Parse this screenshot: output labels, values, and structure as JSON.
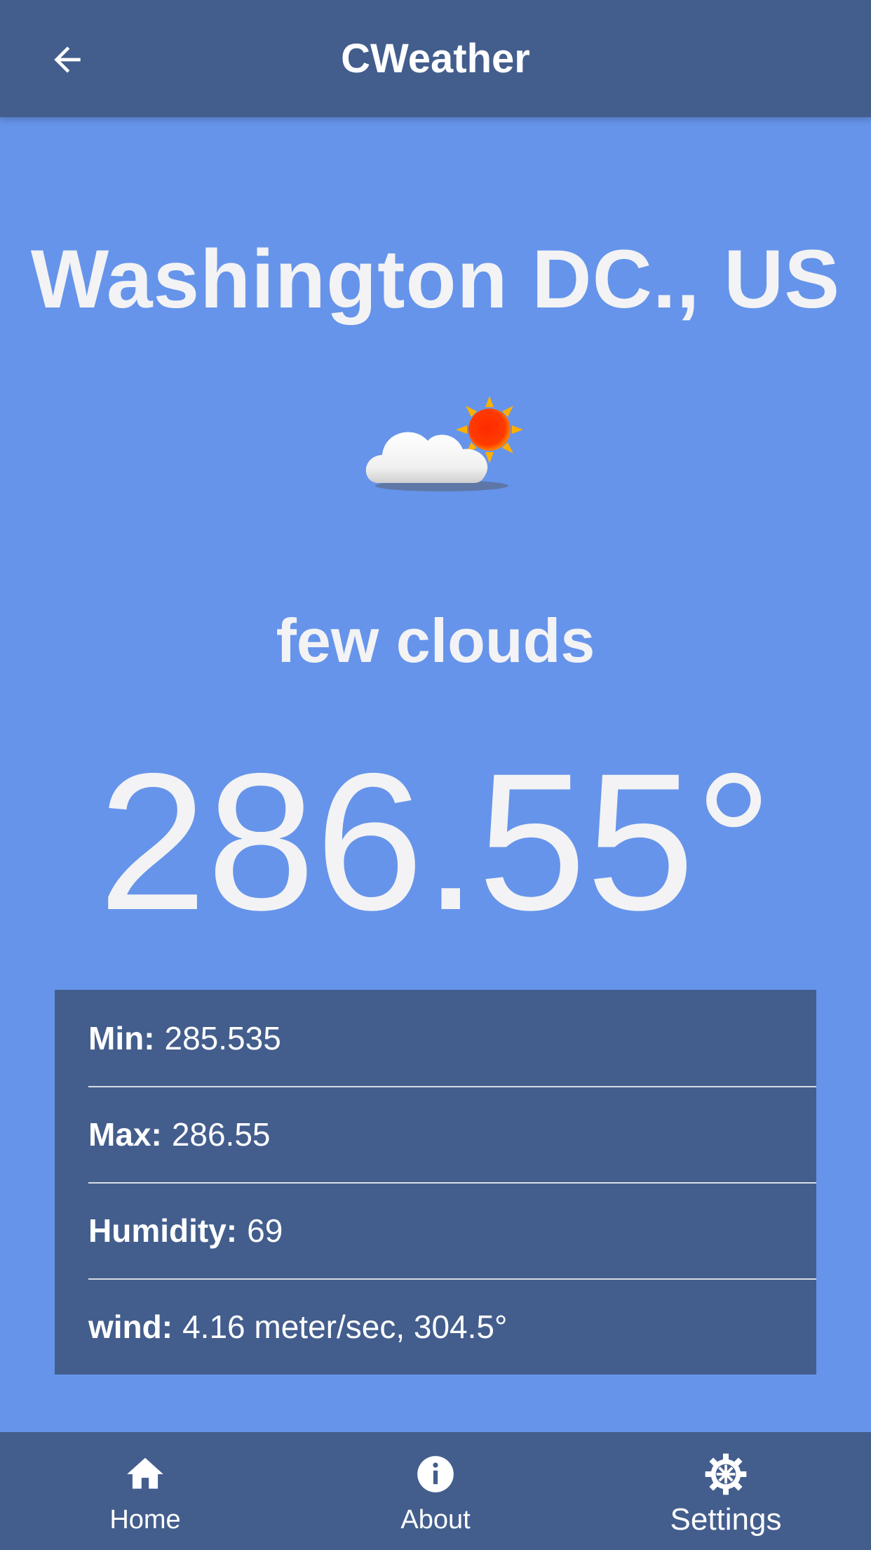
{
  "header": {
    "title": "CWeather",
    "back_icon": "arrow-left-icon"
  },
  "weather": {
    "location": "Washington DC., US",
    "icon": "partly-cloudy-icon",
    "description": "few clouds",
    "temperature": "286.55°"
  },
  "details": [
    {
      "label": "Min:",
      "value": "285.535"
    },
    {
      "label": "Max:",
      "value": "286.55"
    },
    {
      "label": "Humidity:",
      "value": "69"
    },
    {
      "label": "wind:",
      "value": "4.16 meter/sec, 304.5°"
    }
  ],
  "nav": [
    {
      "label": "Home",
      "icon": "home-icon"
    },
    {
      "label": "About",
      "icon": "info-icon"
    },
    {
      "label": "Settings",
      "icon": "gear-icon"
    }
  ],
  "colors": {
    "background": "#6694ea",
    "bar": "#435e8d",
    "text": "#f3f3f5"
  }
}
